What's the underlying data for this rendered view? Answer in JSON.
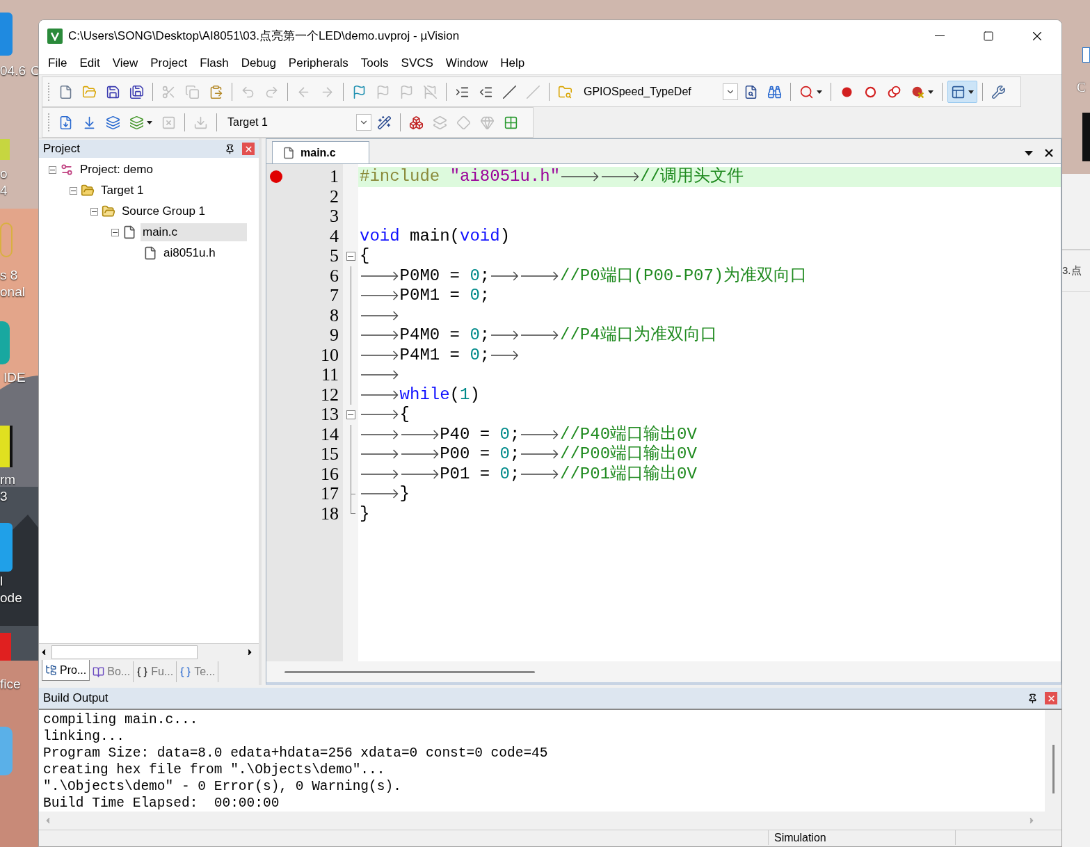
{
  "desktop": {
    "left_labels": [
      "04.6",
      "C",
      "o",
      "4",
      "s 8",
      "onal",
      "IDE",
      "rm",
      "3",
      "l",
      "ode",
      "fice"
    ],
    "right_labels": [
      "C"
    ],
    "behind_window_text": "3.点"
  },
  "window": {
    "title": "C:\\Users\\SONG\\Desktop\\AI8051\\03.点亮第一个LED\\demo.uvproj - µVision"
  },
  "menu": [
    "File",
    "Edit",
    "View",
    "Project",
    "Flash",
    "Debug",
    "Peripherals",
    "Tools",
    "SVCS",
    "Window",
    "Help"
  ],
  "toolbar_1": [
    {
      "kind": "button",
      "disabled": false,
      "pressed": false
    },
    {
      "kind": "button",
      "disabled": false,
      "pressed": false
    },
    {
      "kind": "button",
      "disabled": false,
      "pressed": false
    },
    {
      "kind": "button",
      "disabled": false,
      "pressed": false
    },
    {
      "kind": "separator"
    },
    {
      "kind": "button",
      "disabled": true,
      "pressed": false
    },
    {
      "kind": "button",
      "disabled": true,
      "pressed": false
    },
    {
      "kind": "button",
      "disabled": false,
      "pressed": false
    },
    {
      "kind": "separator"
    },
    {
      "kind": "button",
      "disabled": true,
      "pressed": false
    },
    {
      "kind": "button",
      "disabled": true,
      "pressed": false
    },
    {
      "kind": "separator"
    },
    {
      "kind": "button",
      "disabled": true,
      "pressed": false
    },
    {
      "kind": "button",
      "disabled": true,
      "pressed": false
    },
    {
      "kind": "separator"
    },
    {
      "kind": "button",
      "disabled": false,
      "pressed": false
    },
    {
      "kind": "button",
      "disabled": true,
      "pressed": false
    },
    {
      "kind": "button",
      "disabled": true,
      "pressed": false
    },
    {
      "kind": "button",
      "disabled": true,
      "pressed": false
    },
    {
      "kind": "separator"
    },
    {
      "kind": "button",
      "disabled": false,
      "pressed": false
    },
    {
      "kind": "button",
      "disabled": false,
      "pressed": false
    },
    {
      "kind": "button",
      "disabled": false,
      "pressed": false
    },
    {
      "kind": "button",
      "disabled": true,
      "pressed": false
    },
    {
      "kind": "separator"
    },
    {
      "kind": "button",
      "disabled": false,
      "pressed": false
    },
    {
      "kind": "combo",
      "value": "GPIOSpeed_TypeDef"
    },
    {
      "kind": "button",
      "disabled": false,
      "pressed": false
    },
    {
      "kind": "button",
      "disabled": false,
      "pressed": false
    },
    {
      "kind": "separator"
    },
    {
      "kind": "split",
      "disabled": false,
      "pressed": false
    },
    {
      "kind": "separator"
    },
    {
      "kind": "button",
      "disabled": false,
      "pressed": false
    },
    {
      "kind": "button",
      "disabled": false,
      "pressed": false
    },
    {
      "kind": "button",
      "disabled": false,
      "pressed": false
    },
    {
      "kind": "split",
      "disabled": false,
      "pressed": false
    },
    {
      "kind": "separator"
    },
    {
      "kind": "split",
      "disabled": false,
      "pressed": true
    },
    {
      "kind": "separator"
    },
    {
      "kind": "button",
      "disabled": false,
      "pressed": false
    }
  ],
  "toolbar_2": [
    {
      "kind": "button",
      "disabled": false,
      "pressed": false
    },
    {
      "kind": "button",
      "disabled": false,
      "pressed": false
    },
    {
      "kind": "button",
      "disabled": false,
      "pressed": false
    },
    {
      "kind": "split",
      "disabled": false,
      "pressed": false
    },
    {
      "kind": "button",
      "disabled": true,
      "pressed": false
    },
    {
      "kind": "separator"
    },
    {
      "kind": "button",
      "disabled": true,
      "pressed": false
    },
    {
      "kind": "separator"
    },
    {
      "kind": "combo",
      "value": "Target 1"
    },
    {
      "kind": "button",
      "disabled": false,
      "pressed": false
    },
    {
      "kind": "separator"
    },
    {
      "kind": "button",
      "disabled": false,
      "pressed": false
    },
    {
      "kind": "button",
      "disabled": true,
      "pressed": false
    },
    {
      "kind": "button",
      "disabled": true,
      "pressed": false
    },
    {
      "kind": "button",
      "disabled": true,
      "pressed": false
    },
    {
      "kind": "button",
      "disabled": false,
      "pressed": false
    }
  ],
  "project_panel": {
    "title": "Project",
    "tree": [
      {
        "kind": "project",
        "label": "Project: demo",
        "expanded": true,
        "selected": false,
        "children": [
          {
            "kind": "target",
            "label": "Target 1",
            "expanded": true,
            "selected": false,
            "children": [
              {
                "kind": "folder",
                "label": "Source Group 1",
                "expanded": true,
                "selected": false,
                "children": [
                  {
                    "kind": "file",
                    "label": "main.c",
                    "expanded": true,
                    "selected": true,
                    "children": [
                      {
                        "kind": "file",
                        "label": "ai8051u.h",
                        "selected": false
                      }
                    ]
                  }
                ]
              }
            ]
          }
        ]
      }
    ],
    "tabs": [
      {
        "kind": "project",
        "label": "Pro...",
        "selected": true
      },
      {
        "kind": "books",
        "label": "Bo...",
        "selected": false
      },
      {
        "kind": "functions",
        "label": "Fu...",
        "selected": false
      },
      {
        "kind": "templates",
        "label": "Te...",
        "selected": false
      }
    ]
  },
  "editor": {
    "tabs": [
      {
        "label": "main.c",
        "selected": true
      }
    ],
    "lines": [
      {
        "number": "1",
        "kind": "plain",
        "breakpoint": true,
        "highlighted": true,
        "tokens": [
          {
            "kind": "preproc",
            "text": "#include "
          },
          {
            "kind": "string",
            "text": "\"ai8051u.h\""
          },
          {
            "kind": "tab"
          },
          {
            "kind": "tab"
          },
          {
            "kind": "comment",
            "text": "//调用头文件"
          }
        ]
      },
      {
        "number": "2",
        "kind": "plain",
        "breakpoint": false,
        "highlighted": false
      },
      {
        "number": "3",
        "kind": "plain",
        "breakpoint": false,
        "highlighted": false
      },
      {
        "number": "4",
        "kind": "plain",
        "breakpoint": false,
        "highlighted": false,
        "tokens": [
          {
            "kind": "keyword",
            "text": "void"
          },
          {
            "kind": "plain",
            "text": " main("
          },
          {
            "kind": "keyword",
            "text": "void"
          },
          {
            "kind": "plain",
            "text": ")"
          }
        ]
      },
      {
        "number": "5",
        "kind": "fold_start",
        "breakpoint": false,
        "highlighted": false,
        "tokens": [
          {
            "kind": "plain",
            "text": "{"
          }
        ]
      },
      {
        "number": "6",
        "kind": "fold_body",
        "breakpoint": false,
        "highlighted": false,
        "tokens": [
          {
            "kind": "tab"
          },
          {
            "kind": "plain",
            "text": "P0M0 = "
          },
          {
            "kind": "number",
            "text": "0"
          },
          {
            "kind": "plain",
            "text": ";"
          },
          {
            "kind": "tab"
          },
          {
            "kind": "tab"
          },
          {
            "kind": "comment",
            "text": "//P0端口(P00-P07)为准双向口"
          }
        ]
      },
      {
        "number": "7",
        "kind": "fold_body",
        "breakpoint": false,
        "highlighted": false,
        "tokens": [
          {
            "kind": "tab"
          },
          {
            "kind": "plain",
            "text": "P0M1 = "
          },
          {
            "kind": "number",
            "text": "0"
          },
          {
            "kind": "plain",
            "text": ";"
          }
        ]
      },
      {
        "number": "8",
        "kind": "fold_body",
        "breakpoint": false,
        "highlighted": false,
        "tokens": [
          {
            "kind": "tab"
          }
        ]
      },
      {
        "number": "9",
        "kind": "fold_body",
        "breakpoint": false,
        "highlighted": false,
        "tokens": [
          {
            "kind": "tab"
          },
          {
            "kind": "plain",
            "text": "P4M0 = "
          },
          {
            "kind": "number",
            "text": "0"
          },
          {
            "kind": "plain",
            "text": ";"
          },
          {
            "kind": "tab"
          },
          {
            "kind": "tab"
          },
          {
            "kind": "comment",
            "text": "//P4端口为准双向口"
          }
        ]
      },
      {
        "number": "10",
        "kind": "fold_body",
        "breakpoint": false,
        "highlighted": false,
        "tokens": [
          {
            "kind": "tab"
          },
          {
            "kind": "plain",
            "text": "P4M1 = "
          },
          {
            "kind": "number",
            "text": "0"
          },
          {
            "kind": "plain",
            "text": ";"
          },
          {
            "kind": "tab"
          }
        ]
      },
      {
        "number": "11",
        "kind": "fold_body",
        "breakpoint": false,
        "highlighted": false,
        "tokens": [
          {
            "kind": "tab"
          }
        ]
      },
      {
        "number": "12",
        "kind": "fold_body",
        "breakpoint": false,
        "highlighted": false,
        "tokens": [
          {
            "kind": "tab"
          },
          {
            "kind": "keyword",
            "text": "while"
          },
          {
            "kind": "plain",
            "text": "("
          },
          {
            "kind": "number",
            "text": "1"
          },
          {
            "kind": "plain",
            "text": ")"
          }
        ]
      },
      {
        "number": "13",
        "kind": "fold_start",
        "breakpoint": false,
        "highlighted": false,
        "tokens": [
          {
            "kind": "tab"
          },
          {
            "kind": "plain",
            "text": "{"
          }
        ]
      },
      {
        "number": "14",
        "kind": "fold_body",
        "breakpoint": false,
        "highlighted": false,
        "tokens": [
          {
            "kind": "tab"
          },
          {
            "kind": "tab"
          },
          {
            "kind": "plain",
            "text": "P40 = "
          },
          {
            "kind": "number",
            "text": "0"
          },
          {
            "kind": "plain",
            "text": ";"
          },
          {
            "kind": "tab"
          },
          {
            "kind": "comment",
            "text": "//P40端口输出0V"
          }
        ]
      },
      {
        "number": "15",
        "kind": "fold_body",
        "breakpoint": false,
        "highlighted": false,
        "tokens": [
          {
            "kind": "tab"
          },
          {
            "kind": "tab"
          },
          {
            "kind": "plain",
            "text": "P00 = "
          },
          {
            "kind": "number",
            "text": "0"
          },
          {
            "kind": "plain",
            "text": ";"
          },
          {
            "kind": "tab"
          },
          {
            "kind": "comment",
            "text": "//P00端口输出0V"
          }
        ]
      },
      {
        "number": "16",
        "kind": "fold_body",
        "breakpoint": false,
        "highlighted": false,
        "tokens": [
          {
            "kind": "tab"
          },
          {
            "kind": "tab"
          },
          {
            "kind": "plain",
            "text": "P01 = "
          },
          {
            "kind": "number",
            "text": "0"
          },
          {
            "kind": "plain",
            "text": ";"
          },
          {
            "kind": "tab"
          },
          {
            "kind": "comment",
            "text": "//P01端口输出0V"
          }
        ]
      },
      {
        "number": "17",
        "kind": "fold_branch",
        "breakpoint": false,
        "highlighted": false,
        "tokens": [
          {
            "kind": "tab"
          },
          {
            "kind": "plain",
            "text": "}"
          }
        ]
      },
      {
        "number": "18",
        "kind": "fold_end",
        "breakpoint": false,
        "highlighted": false,
        "tokens": [
          {
            "kind": "plain",
            "text": "}"
          }
        ]
      }
    ]
  },
  "build_output": {
    "title": "Build Output",
    "lines": [
      "compiling main.c...",
      "linking...",
      "Program Size: data=8.0 edata+hdata=256 xdata=0 const=0 code=45",
      "creating hex file from \".\\Objects\\demo\"...",
      "\".\\Objects\\demo\" - 0 Error(s), 0 Warning(s).",
      "Build Time Elapsed:  00:00:00"
    ]
  },
  "status_bar": {
    "mode": "Simulation"
  }
}
